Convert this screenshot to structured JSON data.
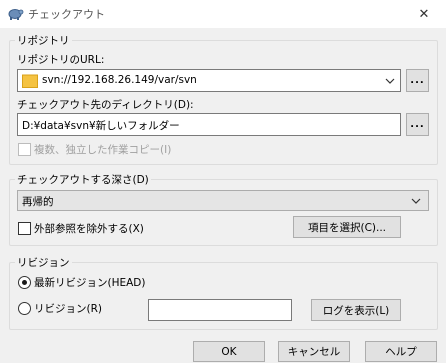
{
  "window": {
    "title": "チェックアウト",
    "close_symbol": "✕"
  },
  "repository": {
    "group_title": "リポジトリ",
    "url_label": "リポジトリのURL:",
    "url_value": "svn://192.168.26.149/var/svn",
    "browse_label": "...",
    "dir_label": "チェックアウト先のディレクトリ(D):",
    "dir_value": "D:¥data¥svn¥新しいフォルダー",
    "dir_browse_label": "...",
    "multiple_copies_label": "複数、独立した作業コピー(I)"
  },
  "depth": {
    "group_title": "チェックアウトする深さ(D)",
    "selected": "再帰的",
    "omit_externals_label": "外部参照を除外する(X)",
    "choose_items_label": "項目を選択(C)..."
  },
  "revision": {
    "group_title": "リビジョン",
    "head_label": "最新リビジョン(HEAD)",
    "revision_label": "リビジョン(R)",
    "revision_value": "",
    "show_log_label": "ログを表示(L)"
  },
  "buttons": {
    "ok": "OK",
    "cancel": "キャンセル",
    "help": "ヘルプ"
  },
  "colors": {
    "window_bg": "#f0f0f0",
    "folder": "#f5c342"
  }
}
